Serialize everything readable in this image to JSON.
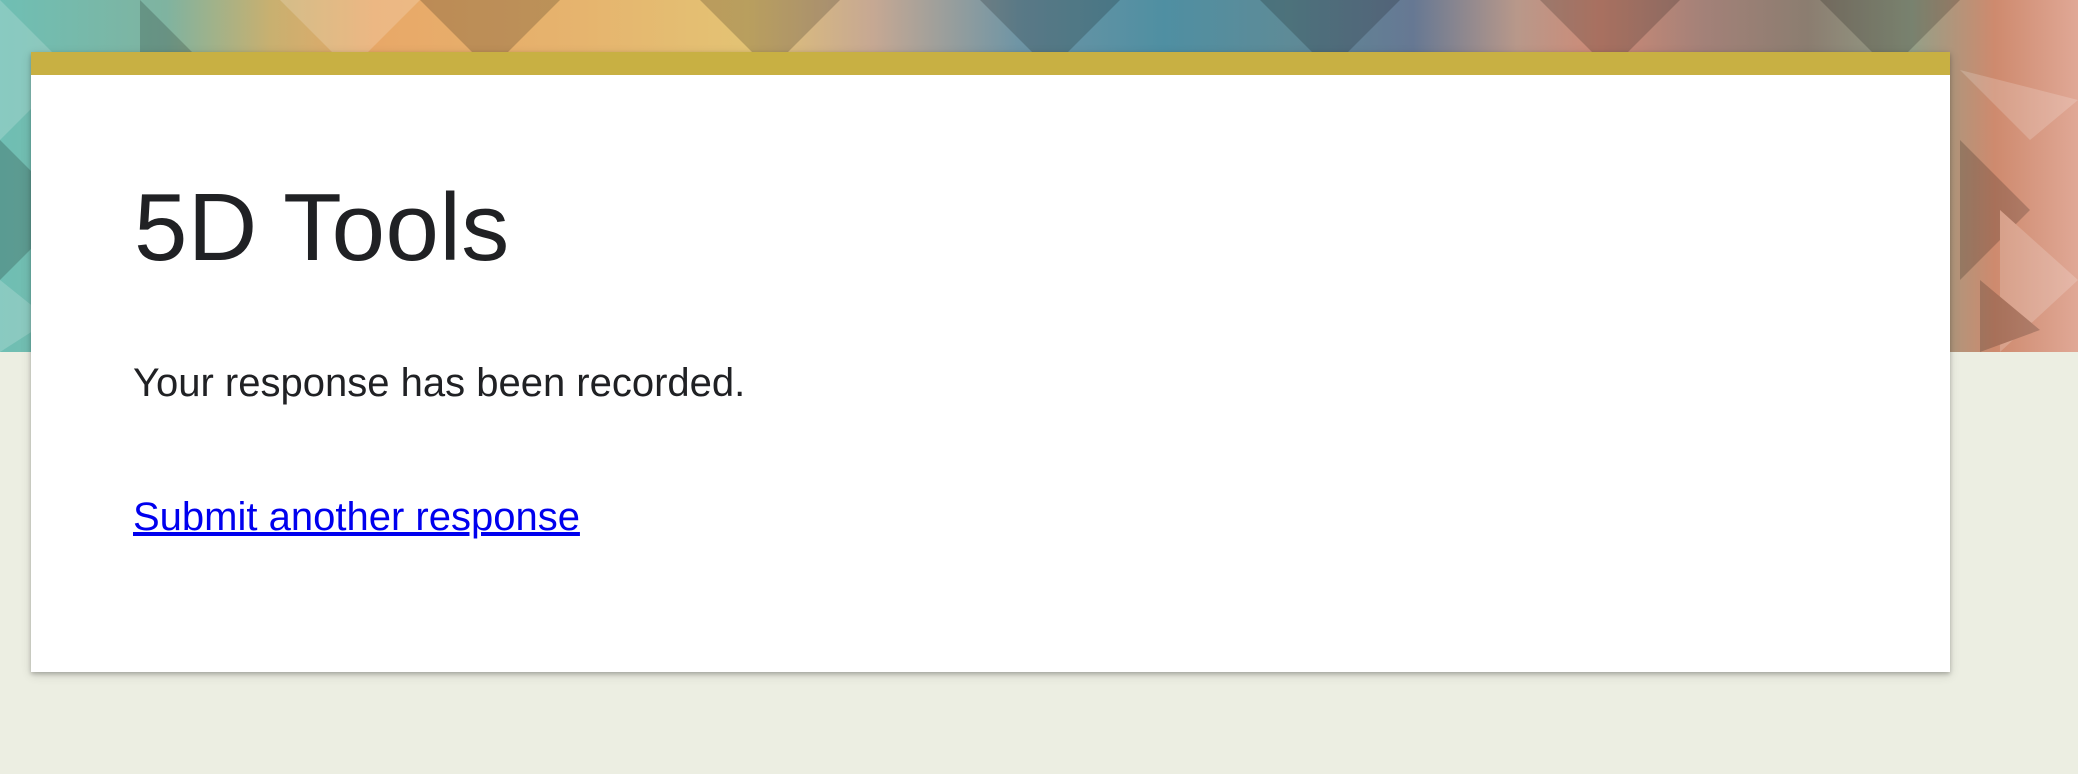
{
  "form": {
    "title": "5D Tools",
    "confirmation_message": "Your response has been recorded.",
    "submit_another_label": "Submit another response"
  },
  "theme": {
    "accent_color": "#c8b043",
    "page_background": "#eceee2",
    "link_color": "#0000ee",
    "header_pattern": "multicolor triangle mosaic"
  }
}
